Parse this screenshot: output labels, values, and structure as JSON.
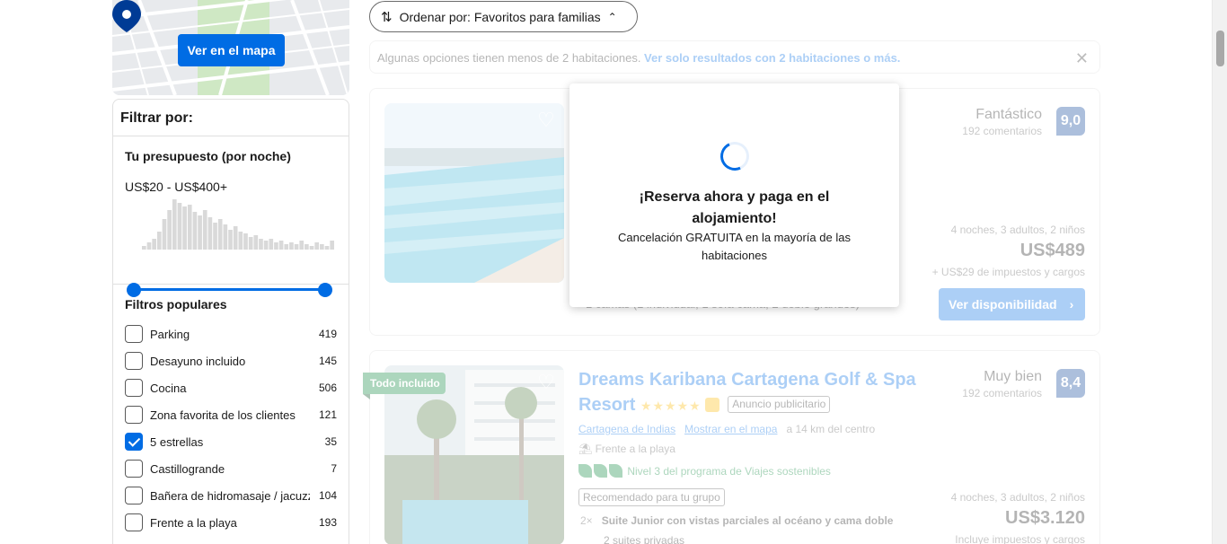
{
  "map": {
    "button_label": "Ver en el mapa"
  },
  "filters": {
    "title": "Filtrar por:",
    "budget": {
      "title": "Tu presupuesto (por noche)",
      "range": "US$20 - US$400+"
    },
    "popular": {
      "title": "Filtros populares",
      "items": [
        {
          "label": "Parking",
          "count": "419",
          "checked": false
        },
        {
          "label": "Desayuno incluido",
          "count": "145",
          "checked": false
        },
        {
          "label": "Cocina",
          "count": "506",
          "checked": false
        },
        {
          "label": "Zona favorita de los clientes",
          "count": "121",
          "checked": false
        },
        {
          "label": "5 estrellas",
          "count": "35",
          "checked": true
        },
        {
          "label": "Castillogrande",
          "count": "7",
          "checked": false
        },
        {
          "label": "Bañera de hidromasaje / jacuzzi",
          "count": "104",
          "checked": false
        },
        {
          "label": "Frente a la playa",
          "count": "193",
          "checked": false
        }
      ]
    }
  },
  "sort": {
    "label": "Ordenar por: Favoritos para familias"
  },
  "notice": {
    "text": "Algunas opciones tienen menos de 2 habitaciones. ",
    "link": "Ver solo resultados con 2 habitaciones o más."
  },
  "card1": {
    "score_word": "Fantástico",
    "reviews": "192 comentarios",
    "score": "9,0",
    "nights": "4 noches, 3 adultos, 2 niños",
    "price": "US$489",
    "taxes": "+ US$29 de impuestos y cargos",
    "availability": "Ver disponibilidad",
    "bed_text": "1 camas (1 individual, 1 sofá cama, 2 doble grandes)"
  },
  "card2": {
    "badge": "Todo incluido",
    "title": "Dreams Karibana Cartagena Golf & Spa Resort",
    "stars": "★★★★★",
    "ad": "Anuncio publicitario",
    "location": "Cartagena de Indias",
    "map_link": "Mostrar en el mapa",
    "distance": "a 14 km del centro",
    "beach": "Frente a la playa",
    "eco": "Nivel 3 del programa de Viajes sostenibles",
    "recommended": "Recomendado para tu grupo",
    "room_qty": "2×",
    "room": "Suite Junior con vistas parciales al océano y cama doble",
    "room_sub": "2 suites privadas",
    "score_word": "Muy bien",
    "reviews": "192 comentarios",
    "score": "8,4",
    "nights": "4 noches, 3 adultos, 2 niños",
    "price": "US$3.120",
    "taxes": "Incluye impuestos y cargos"
  },
  "popup": {
    "title": "¡Reserva ahora y paga en el alojamiento!",
    "subtitle": "Cancelación GRATUITA en la mayoría de las habitaciones"
  },
  "colors": {
    "accent": "#006ce4",
    "score": "#003b95",
    "green": "#008234",
    "star": "#febb02"
  }
}
